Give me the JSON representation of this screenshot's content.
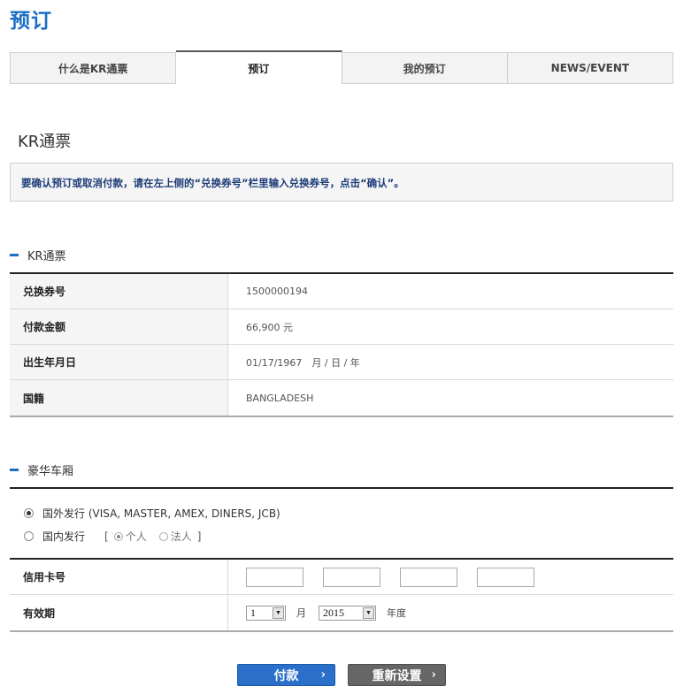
{
  "page": {
    "title": "预订"
  },
  "tabs": [
    {
      "label": "什么是KR通票",
      "active": false
    },
    {
      "label": "预订",
      "active": true
    },
    {
      "label": "我的预订",
      "active": false
    },
    {
      "label": "NEWS/EVENT",
      "active": false
    }
  ],
  "section": {
    "title": "KR通票"
  },
  "notice": {
    "text": "要确认预订或取消付款，请在左上侧的“兑换券号”栏里输入兑换券号，点击“确认”。"
  },
  "pass_info": {
    "heading": "KR通票",
    "rows": [
      {
        "label": "兑换券号",
        "value": "1500000194"
      },
      {
        "label": "付款金额",
        "value": "66,900 元"
      },
      {
        "label": "出生年月日",
        "value": "01/17/1967　月 / 日 / 年"
      },
      {
        "label": "国籍",
        "value": "BANGLADESH"
      }
    ]
  },
  "payment": {
    "heading": "豪华车厢",
    "option_foreign": "国外发行 (VISA, MASTER, AMEX, DINERS, JCB)",
    "option_domestic": "国内发行",
    "bracket_open": "[",
    "bracket_close": "]",
    "sub_personal": "个人",
    "sub_corporate": "法人",
    "selected_option": "foreign",
    "card_number_label": "信用卡号",
    "card_number_values": [
      "",
      "",
      "",
      ""
    ],
    "expiry_label": "有效期",
    "expiry_month": "1",
    "month_unit": "月",
    "expiry_year": "2015",
    "year_unit": "年度"
  },
  "buttons": {
    "pay": "付款",
    "reset": "重新设置"
  },
  "colors": {
    "accent": "#1a6fc4",
    "notice_text": "#1c3c78",
    "pay_button": "#2a6fc9",
    "reset_button": "#666666"
  }
}
